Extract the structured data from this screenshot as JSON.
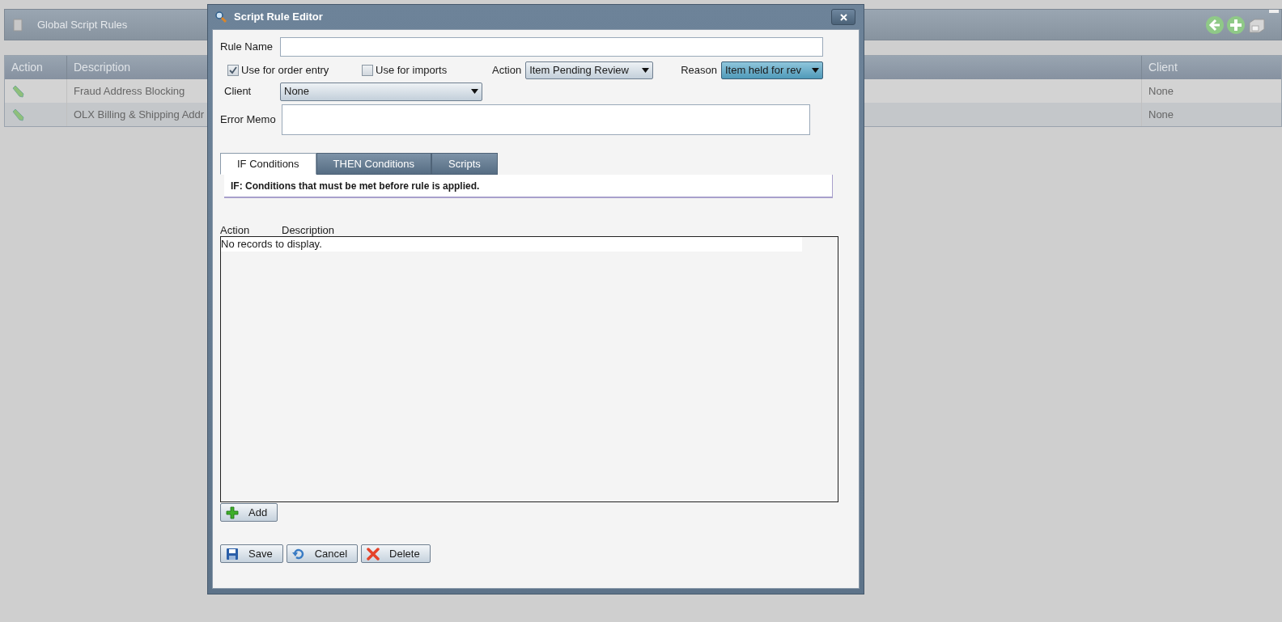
{
  "page": {
    "title": "Global Script Rules"
  },
  "table": {
    "columns": [
      "Action",
      "Description",
      "Client"
    ],
    "rows": [
      {
        "description": "Fraud Address Blocking",
        "client": "None"
      },
      {
        "description": "OLX Billing & Shipping Addr",
        "client": "None"
      }
    ]
  },
  "dialog": {
    "title": "Script Rule Editor",
    "rule_name": {
      "label": "Rule Name"
    },
    "checkboxes": [
      {
        "label": "Use for order entry",
        "checked": true
      },
      {
        "label": "Use for imports",
        "checked": false
      }
    ],
    "action": {
      "label": "Action",
      "value": "Item Pending Review"
    },
    "reason": {
      "label": "Reason",
      "value": "Item held for rev"
    },
    "client": {
      "label": "Client",
      "value": "None"
    },
    "error_memo": {
      "label": "Error Memo"
    },
    "tabs": [
      {
        "label": "IF Conditions",
        "selected": true
      },
      {
        "label": "THEN Conditions",
        "selected": false
      },
      {
        "label": "Scripts",
        "selected": false
      }
    ],
    "tab_description": "IF: Conditions that must be met before rule is applied.",
    "grid": {
      "columns": [
        "Action",
        "Description"
      ],
      "empty_text": "No records to display."
    },
    "add_button": {
      "kind": "add",
      "label": "Add"
    },
    "buttons": [
      {
        "kind": "save",
        "label": "Save"
      },
      {
        "kind": "cancel",
        "label": "Cancel"
      },
      {
        "kind": "delete",
        "label": "Delete"
      }
    ]
  }
}
